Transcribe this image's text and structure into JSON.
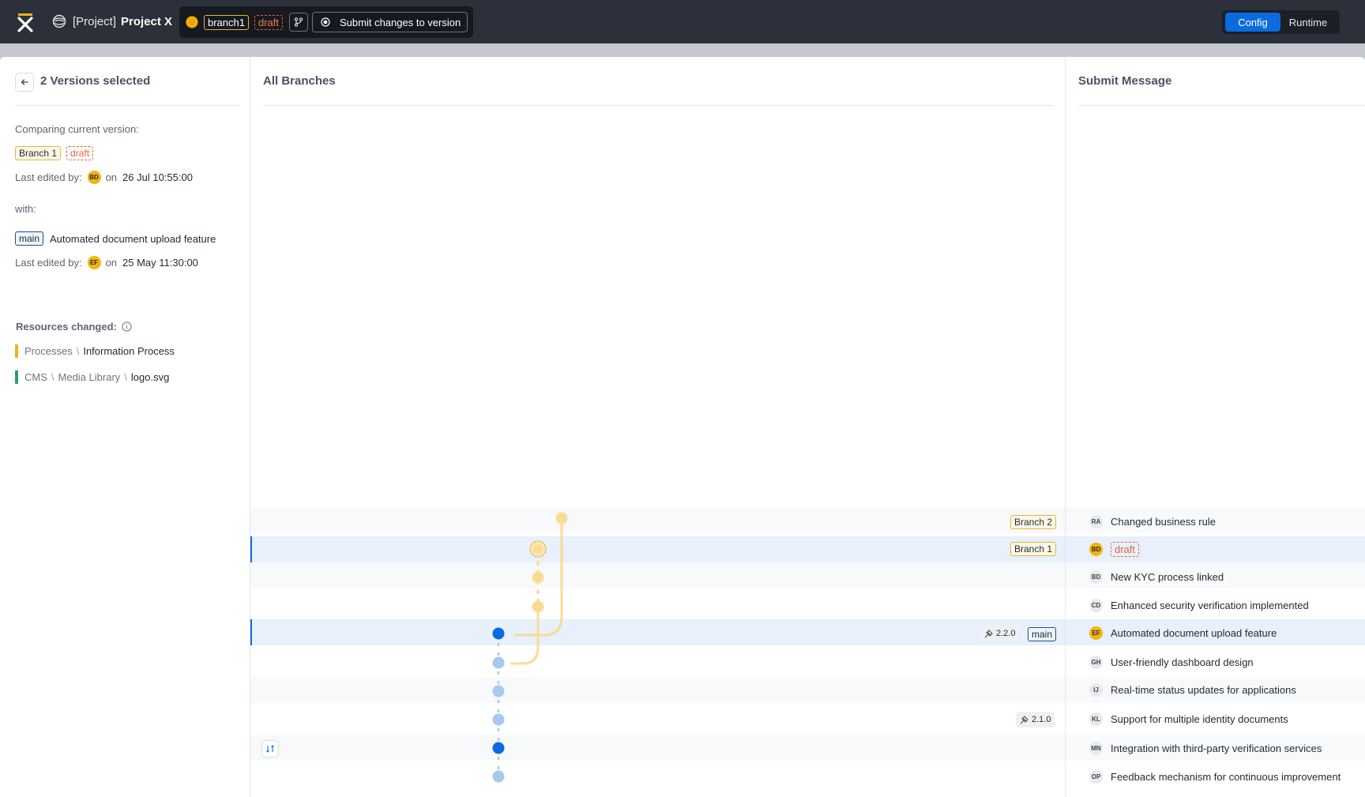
{
  "topbar": {
    "project_prefix": "[Project]",
    "project_name": "Project X",
    "branch_tag": "branch1",
    "draft_tag": "draft",
    "submit_label": "Submit changes to version",
    "modes": [
      "Config",
      "Runtime"
    ],
    "active_mode": "Config"
  },
  "left": {
    "title": "2 Versions selected",
    "comparing_label": "Comparing current version:",
    "current_branch": "Branch 1",
    "current_state": "draft",
    "last_edited_label": "Last edited by:",
    "current_editor": "BD",
    "on_label": "on",
    "current_date": "26 Jul 10:55:00",
    "with_label": "with:",
    "other_branch": "main",
    "other_message": "Automated document upload feature",
    "other_editor": "EF",
    "other_date": "25  May 11:30:00",
    "resources_label": "Resources changed:",
    "resources": [
      {
        "path": [
          "Processes"
        ],
        "name": "Information Process",
        "color": "#f2b01e"
      },
      {
        "path": [
          "CMS",
          "Media Library"
        ],
        "name": "logo.svg",
        "color": "#2a9d6f"
      }
    ]
  },
  "mid": {
    "title": "All Branches",
    "branch2_tag": "Branch 2",
    "branch1_tag": "Branch 1",
    "v220": "2.2.0",
    "main_tag": "main",
    "v210": "2.1.0"
  },
  "right": {
    "title": "Submit Message",
    "rows": [
      {
        "initials": "RA",
        "message": "Changed business rule",
        "highlight": false
      },
      {
        "initials": "BD",
        "message": "draft",
        "highlight": true,
        "is_draft": true
      },
      {
        "initials": "BD",
        "message": "New KYC process linked",
        "highlight": false
      },
      {
        "initials": "CD",
        "message": "Enhanced security verification implemented",
        "highlight": false
      },
      {
        "initials": "EF",
        "message": "Automated document upload feature",
        "highlight": true
      },
      {
        "initials": "GH",
        "message": "User-friendly dashboard design",
        "highlight": false
      },
      {
        "initials": "IJ",
        "message": "Real-time status updates for applications",
        "highlight": false
      },
      {
        "initials": "KL",
        "message": "Support for multiple identity documents",
        "highlight": false
      },
      {
        "initials": "MN",
        "message": "Integration with third-party verification services",
        "highlight": false
      },
      {
        "initials": "OP",
        "message": "Feedback mechanism for continuous improvement",
        "highlight": false
      }
    ]
  },
  "colors": {
    "accent": "#0b6bde",
    "branch_yellow": "#f9dc93",
    "main_blue": "#0b6bde",
    "main_light": "#a9c8ee"
  }
}
